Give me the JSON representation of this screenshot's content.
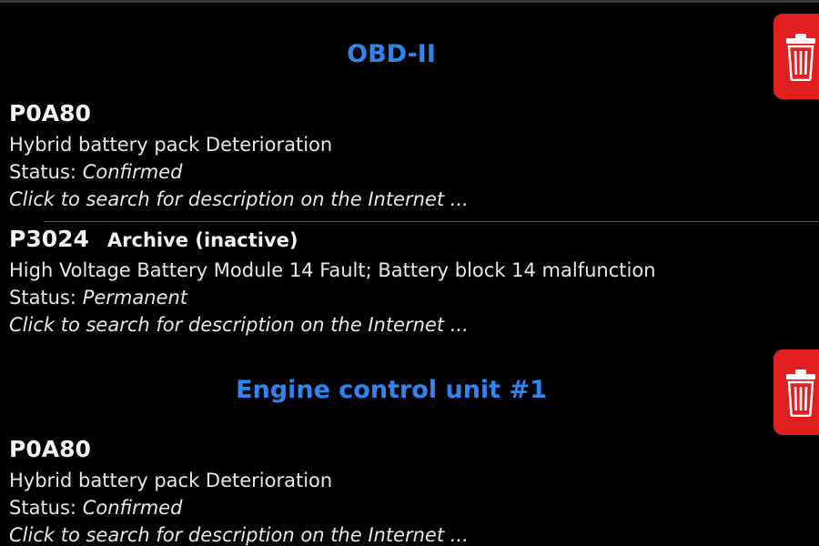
{
  "sections": [
    {
      "title": "OBD-II",
      "codes": [
        {
          "code": "P0A80",
          "tag": "",
          "description": "Hybrid battery pack Deterioration",
          "status_label": "Status:",
          "status_value": "Confirmed",
          "search_text": "Click to search for description on the Internet ..."
        },
        {
          "code": "P3024",
          "tag": "Archive (inactive)",
          "description": "High Voltage Battery Module 14 Fault; Battery block 14 malfunction",
          "status_label": "Status:",
          "status_value": "Permanent",
          "search_text": "Click to search for description on the Internet ..."
        }
      ]
    },
    {
      "title": "Engine control unit #1",
      "codes": [
        {
          "code": "P0A80",
          "tag": "",
          "description": "Hybrid battery pack Deterioration",
          "status_label": "Status:",
          "status_value": "Confirmed",
          "search_text": "Click to search for description on the Internet ..."
        }
      ]
    }
  ],
  "colors": {
    "background": "#000000",
    "section_header": "#2f86f0",
    "delete_button": "#e21f1f",
    "text": "#e8e8e8"
  },
  "icons": {
    "delete": "trash-icon"
  }
}
